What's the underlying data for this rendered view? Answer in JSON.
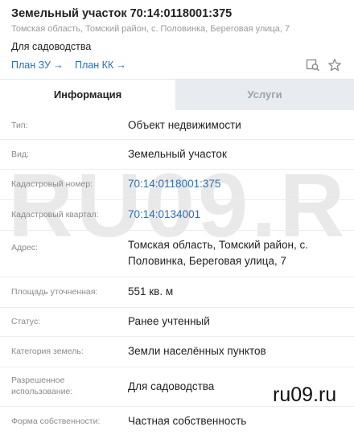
{
  "header": {
    "title": "Земельный участок 70:14:0118001:375",
    "address": "Томская область, Томский район, с. Половинка, Береговая улица, 7",
    "purpose": "Для садоводства",
    "links": [
      {
        "label": "План ЗУ"
      },
      {
        "label": "План КК"
      }
    ],
    "tools": [
      "search-map-icon",
      "star-icon"
    ]
  },
  "tabs": [
    {
      "label": "Информация",
      "active": true
    },
    {
      "label": "Услуги",
      "active": false
    }
  ],
  "details": [
    {
      "label": "Тип:",
      "value": "Объект недвижимости"
    },
    {
      "label": "Вид:",
      "value": "Земельный участок"
    },
    {
      "label": "Кадастровый номер:",
      "value": "70:14:0118001:375"
    },
    {
      "label": "Кадастровый квартал:",
      "value": "70:14:0134001"
    },
    {
      "label": "Адрес:",
      "value": "Томская область, Томский район, с. Половинка, Береговая улица, 7"
    },
    {
      "label": "Площадь уточненная:",
      "value": "551 кв. м"
    },
    {
      "label": "Статус:",
      "value": "Ранее учтенный"
    },
    {
      "label": "Категория земель:",
      "value": "Земли населённых пунктов"
    },
    {
      "label": "Разрешенное использование:",
      "value": "Для садоводства"
    },
    {
      "label": "Форма собственности:",
      "value": "Частная собственность"
    }
  ],
  "watermark": {
    "big": "RU09.R",
    "small": "ru09.ru"
  },
  "colors": {
    "link": "#2c6fb0",
    "tab_inactive_bg": "#e8ecf1",
    "label": "#8a8a8a"
  }
}
